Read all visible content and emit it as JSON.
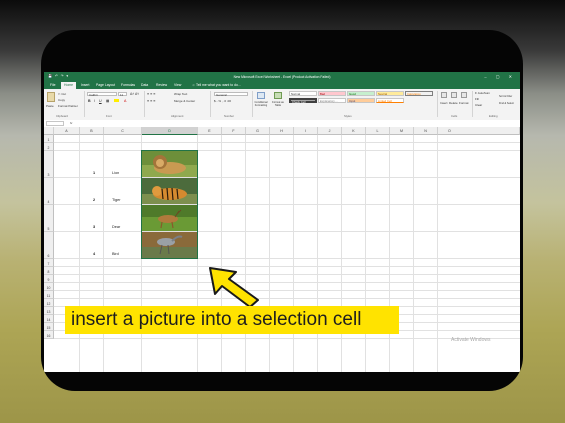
{
  "window": {
    "title": "New Microsoft Excel Worksheet - Excel (Product Activation Failed)",
    "controls": "– ▢ ✕",
    "quick_access": "💾 ↶ ↷ ▾"
  },
  "tabs": [
    {
      "label": "File"
    },
    {
      "label": "Home"
    },
    {
      "label": "Insert"
    },
    {
      "label": "Page Layout"
    },
    {
      "label": "Formulas"
    },
    {
      "label": "Data"
    },
    {
      "label": "Review"
    },
    {
      "label": "View"
    }
  ],
  "tell_me": "Tell me what you want to do...",
  "ribbon": {
    "clipboard": {
      "paste": "Paste",
      "cut": "Cut",
      "copy": "Copy",
      "format_painter": "Format Painter",
      "group": "Clipboard"
    },
    "font": {
      "name": "Calibri",
      "size": "11",
      "group": "Font"
    },
    "alignment": {
      "wrap": "Wrap Text",
      "merge": "Merge & Center",
      "group": "Alignment"
    },
    "number": {
      "format": "General",
      "symbols": "$ - % , .0 .00",
      "group": "Number"
    },
    "styles": {
      "conditional": "Conditional Formatting",
      "format_table": "Format as Table",
      "normal": "Normal",
      "bad": "Bad",
      "good": "Good",
      "neutral": "Neutral",
      "calculation": "Calculation",
      "check_cell": "Check Cell",
      "explanatory": "Explanatory ...",
      "input": "Input",
      "linked_cell": "Linked Cell",
      "group": "Styles"
    },
    "cells": {
      "insert": "Insert",
      "delete": "Delete",
      "format": "Format",
      "group": "Cells"
    },
    "editing": {
      "autosum": "AutoSum",
      "fill": "Fill",
      "clear": "Clear",
      "sort": "Sort & Filter",
      "find": "Find & Select",
      "group": "Editing"
    }
  },
  "formula_bar": {
    "name_box": "",
    "fx": "fx"
  },
  "columns": [
    "A",
    "B",
    "C",
    "D",
    "E",
    "F",
    "G",
    "H",
    "I",
    "J",
    "K",
    "L",
    "M",
    "N",
    "O"
  ],
  "rows": [
    "1",
    "2",
    "3",
    "4",
    "5",
    "6",
    "7",
    "8",
    "9",
    "10",
    "11",
    "12",
    "13",
    "14",
    "15",
    "16"
  ],
  "table": [
    {
      "num": "1",
      "animal": "Lion"
    },
    {
      "num": "2",
      "animal": "Tiger"
    },
    {
      "num": "3",
      "animal": "Dear"
    },
    {
      "num": "4",
      "animal": "Bird"
    }
  ],
  "caption": "insert a picture into a selection cell",
  "watermark": "Activate Windows",
  "colors": {
    "excel_green": "#217346",
    "caption_bg": "#ffe300",
    "arrow": "#ffe300"
  }
}
